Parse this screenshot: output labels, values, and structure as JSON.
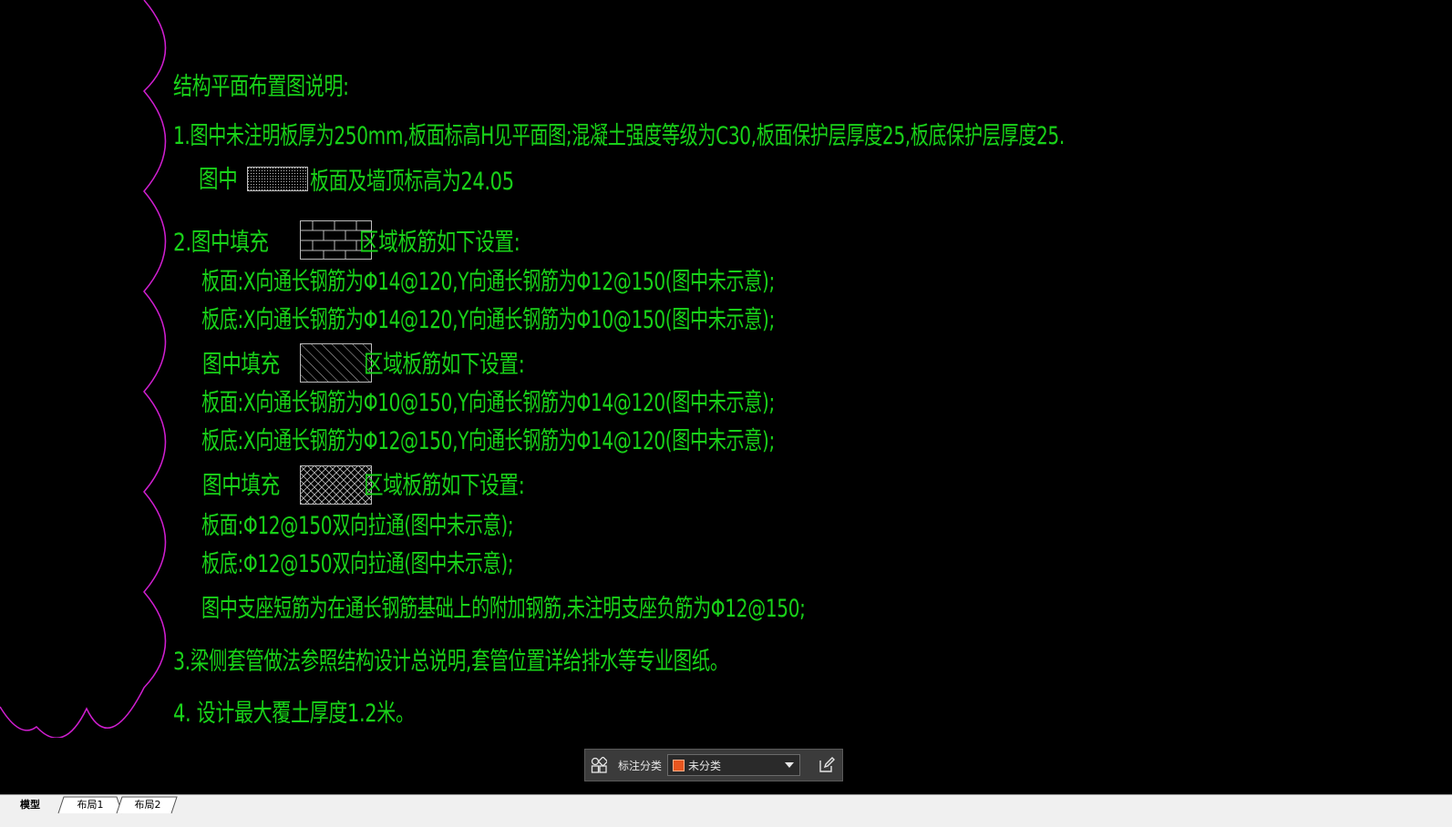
{
  "drawing": {
    "title": "结构平面布置图说明:",
    "line1": "1.图中未注明板厚为250mm,板面标高H见平面图;混凝土强度等级为C30,板面保护层厚度25,板底保护层厚度25.",
    "line1b_prefix": "图中",
    "line1b_suffix": "板面及墙顶标高为24.05",
    "line2_prefix": "2.图中填充",
    "line2_suffix": "区域板筋如下设置:",
    "line2_top": "板面:X向通长钢筋为Φ14@120,Y向通长钢筋为Φ12@150(图中未示意);",
    "line2_bottom": "板底:X向通长钢筋为Φ14@120,Y向通长钢筋为Φ10@150(图中未示意);",
    "line3_prefix": "图中填充",
    "line3_suffix": "区域板筋如下设置:",
    "line3_top": "板面:X向通长钢筋为Φ10@150,Y向通长钢筋为Φ14@120(图中未示意);",
    "line3_bottom": "板底:X向通长钢筋为Φ12@150,Y向通长钢筋为Φ14@120(图中未示意);",
    "line4_prefix": "图中填充",
    "line4_suffix": "区域板筋如下设置:",
    "line4_top": "板面:Φ12@150双向拉通(图中未示意);",
    "line4_bottom": "板底:Φ12@150双向拉通(图中未示意);",
    "line5": "图中支座短筋为在通长钢筋基础上的附加钢筋,未注明支座负筋为Φ12@150;",
    "line6": "3.梁侧套管做法参照结构设计总说明,套管位置详给排水等专业图纸。",
    "line7": "4. 设计最大覆土厚度1.2米。"
  },
  "colors": {
    "text": "#19d219",
    "revision_cloud": "#d01ed0",
    "hatch": "#bdbdbd",
    "category_swatch": "#e8561f"
  },
  "annotation_bar": {
    "label": "标注分类",
    "selected": "未分类",
    "left_icon": "grid-icon",
    "right_icon": "edit-icon"
  },
  "tabs": [
    "模型",
    "布局1",
    "布局2"
  ]
}
